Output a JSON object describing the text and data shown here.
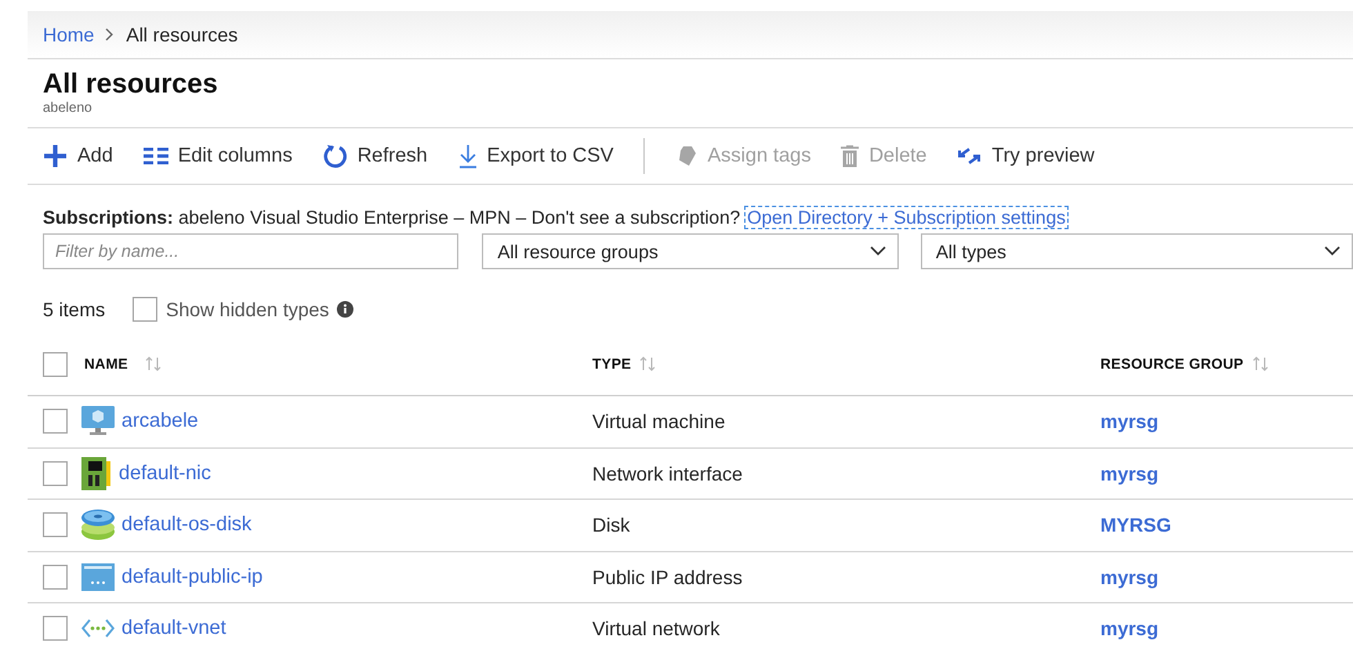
{
  "breadcrumb": [
    {
      "label": "Home",
      "link": true
    },
    {
      "label": "All resources",
      "link": false
    }
  ],
  "header": {
    "title": "All resources",
    "subtitle": "abeleno"
  },
  "toolbar": [
    {
      "kind": "add",
      "label": "Add",
      "disabled": false
    },
    {
      "kind": "columns",
      "label": "Edit columns",
      "disabled": false
    },
    {
      "kind": "refresh",
      "label": "Refresh",
      "disabled": false
    },
    {
      "kind": "export",
      "label": "Export to CSV",
      "disabled": false
    },
    {
      "kind": "separator"
    },
    {
      "kind": "tags",
      "label": "Assign tags",
      "disabled": true
    },
    {
      "kind": "delete",
      "label": "Delete",
      "disabled": true
    },
    {
      "kind": "preview",
      "label": "Try preview",
      "disabled": false
    }
  ],
  "subscriptions": {
    "text": "**Subscriptions:** abeleno Visual Studio Enterprise – MPN – Don't see a subscription?",
    "link": "Open Directory + Subscription settings",
    "link_focused": true
  },
  "filters": {
    "name_placeholder": "Filter by name...",
    "resource_group": "All resource groups",
    "type": "All types"
  },
  "summary": {
    "count": "5 items",
    "show_hidden_label": "Show hidden types",
    "show_hidden_checked": false
  },
  "table": {
    "columns": [
      "NAME",
      "TYPE",
      "RESOURCE GROUP"
    ],
    "select_all_checked": false,
    "rows": [
      {
        "kind": "vm",
        "name": "arcabele",
        "type": "Virtual machine",
        "resource_group": "myrsg",
        "checked": false
      },
      {
        "kind": "nic",
        "name": "default-nic",
        "type": "Network interface",
        "resource_group": "myrsg",
        "checked": false
      },
      {
        "kind": "disk",
        "name": "default-os-disk",
        "type": "Disk",
        "resource_group": "MYRSG",
        "checked": false
      },
      {
        "kind": "ip",
        "name": "default-public-ip",
        "type": "Public IP address",
        "resource_group": "myrsg",
        "checked": false
      },
      {
        "kind": "vnet",
        "name": "default-vnet",
        "type": "Virtual network",
        "resource_group": "myrsg",
        "checked": false
      }
    ]
  }
}
